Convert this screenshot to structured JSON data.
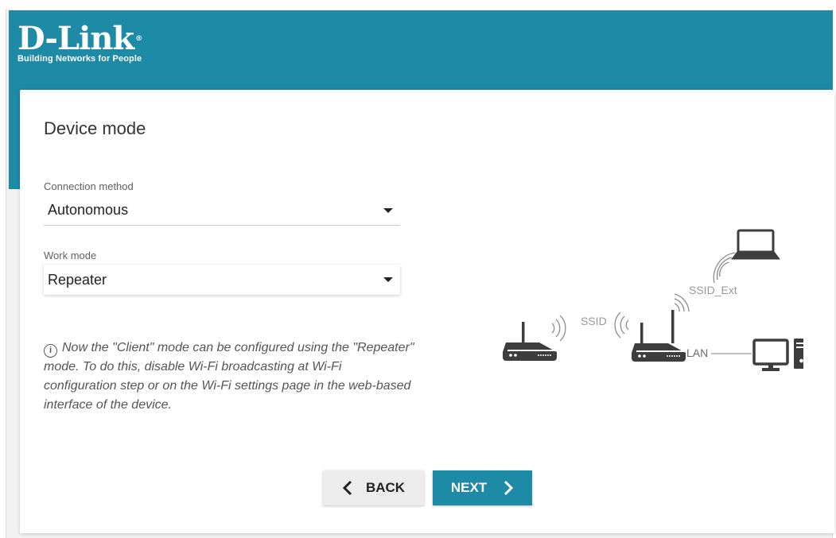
{
  "brand": {
    "name": "D-Link",
    "registered": "®",
    "tagline": "Building Networks for People"
  },
  "page": {
    "title": "Device mode"
  },
  "form": {
    "connection_method": {
      "label": "Connection method",
      "value": "Autonomous"
    },
    "work_mode": {
      "label": "Work mode",
      "value": "Repeater"
    }
  },
  "note": {
    "icon": "info-icon",
    "text": "Now the \"Client\" mode can be configured using the \"Repeater\" mode. To do this, disable Wi-Fi broadcasting at Wi-Fi configuration step or on the Wi-Fi settings page in the web-based interface of the device."
  },
  "diagram": {
    "ssid_label": "SSID",
    "ssid_ext_label": "SSID_Ext",
    "lan_label": "LAN"
  },
  "buttons": {
    "back": "BACK",
    "next": "NEXT"
  },
  "colors": {
    "accent": "#1d8aa6",
    "diagram": "#3d3d3d"
  }
}
